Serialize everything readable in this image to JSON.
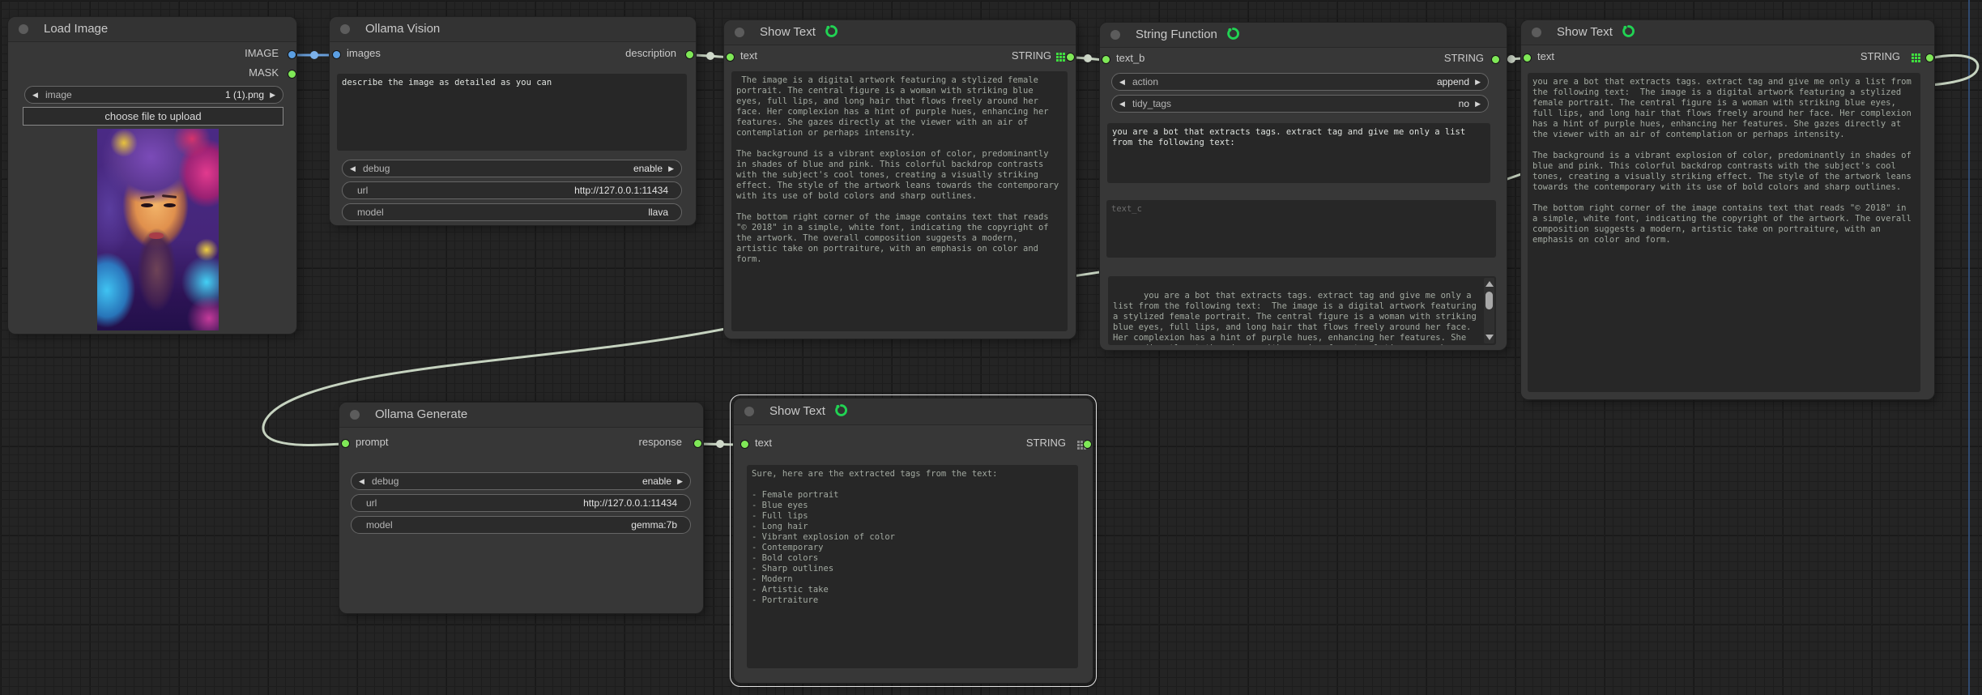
{
  "ui": {
    "arrow_left": "◀",
    "arrow_right": "▶"
  },
  "colors": {
    "wire": "#c6d3c0",
    "wire_image": "#6aa0dc",
    "slot_green": "#7fe857",
    "slot_blue": "#5b9fe3",
    "grid_icon_green": "#3fdd3f",
    "grid_icon_gray": "#8a8a8a",
    "selection": "#e2e2e2",
    "canvas_guide_line": "#33517c"
  },
  "load_image": {
    "title": "Load Image",
    "output_image": "IMAGE",
    "output_mask": "MASK",
    "image_label": "image",
    "image_value": "1 (1).png",
    "upload_label": "choose file to upload"
  },
  "ollama_vision": {
    "title": "Ollama Vision",
    "input": "images",
    "output": "description",
    "prompt_text": "describe the image as detailed as you can",
    "debug_label": "debug",
    "debug_value": "enable",
    "url_label": "url",
    "url_value": "http://127.0.0.1:11434",
    "model_label": "model",
    "model_value": "llava"
  },
  "show_text_1": {
    "title": "Show Text",
    "input": "text",
    "output": "STRING",
    "text": " The image is a digital artwork featuring a stylized female portrait. The central figure is a woman with striking blue eyes, full lips, and long hair that flows freely around her face. Her complexion has a hint of purple hues, enhancing her features. She gazes directly at the viewer with an air of contemplation or perhaps intensity.\n\nThe background is a vibrant explosion of color, predominantly in shades of blue and pink. This colorful backdrop contrasts with the subject's cool tones, creating a visually striking effect. The style of the artwork leans towards the contemporary with its use of bold colors and sharp outlines.\n\nThe bottom right corner of the image contains text that reads \"© 2018\" in a simple, white font, indicating the copyright of the artwork. The overall composition suggests a modern, artistic take on portraiture, with an emphasis on color and form."
  },
  "string_function": {
    "title": "String Function",
    "input": "text_b",
    "output": "STRING",
    "action_label": "action",
    "action_value": "append",
    "tidy_label": "tidy_tags",
    "tidy_value": "no",
    "text_a": "you are a bot that extracts tags. extract tag and give me only a list from the following text:",
    "text_c_placeholder": "text_c",
    "result_text": "you are a bot that extracts tags. extract tag and give me only a list from the following text:  The image is a digital artwork featuring a stylized female portrait. The central figure is a woman with striking blue eyes, full lips, and long hair that flows freely around her face. Her complexion has a hint of purple hues, enhancing her features. She gazes directly at the viewer with an air of contemplation or perhaps intensity."
  },
  "show_text_right": {
    "title": "Show Text",
    "input": "text",
    "output": "STRING",
    "text": "you are a bot that extracts tags. extract tag and give me only a list from the following text:  The image is a digital artwork featuring a stylized female portrait. The central figure is a woman with striking blue eyes, full lips, and long hair that flows freely around her face. Her complexion has a hint of purple hues, enhancing her features. She gazes directly at the viewer with an air of contemplation or perhaps intensity.\n\nThe background is a vibrant explosion of color, predominantly in shades of blue and pink. This colorful backdrop contrasts with the subject's cool tones, creating a visually striking effect. The style of the artwork leans towards the contemporary with its use of bold colors and sharp outlines.\n\nThe bottom right corner of the image contains text that reads \"© 2018\" in a simple, white font, indicating the copyright of the artwork. The overall composition suggests a modern, artistic take on portraiture, with an emphasis on color and form."
  },
  "ollama_generate": {
    "title": "Ollama Generate",
    "input": "prompt",
    "output": "response",
    "debug_label": "debug",
    "debug_value": "enable",
    "url_label": "url",
    "url_value": "http://127.0.0.1:11434",
    "model_label": "model",
    "model_value": "gemma:7b"
  },
  "show_text_bottom": {
    "title": "Show Text",
    "input": "text",
    "output": "STRING",
    "text": "Sure, here are the extracted tags from the text:\n\n- Female portrait\n- Blue eyes\n- Full lips\n- Long hair\n- Vibrant explosion of color\n- Contemporary\n- Bold colors\n- Sharp outlines\n- Modern\n- Artistic take\n- Portraiture"
  }
}
